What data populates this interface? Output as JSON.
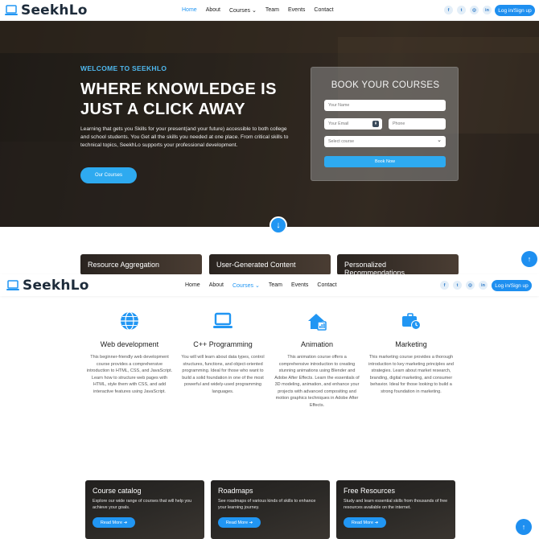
{
  "brand": {
    "name": "SeekhLo",
    "accent": "#2196f3"
  },
  "nav": {
    "links": [
      "Home",
      "About",
      "Courses",
      "Team",
      "Events",
      "Contact"
    ],
    "courses_chevron": "⌄",
    "social": [
      "f",
      "t",
      "◎",
      "in"
    ],
    "login_label": "Log in/Sign up"
  },
  "hero": {
    "welcome": "WELCOME TO SEEKHLO",
    "title": "WHERE KNOWLEDGE IS JUST A CLICK AWAY",
    "description": "Learning that gets you Skills for your present(and your future) accessible to both college and school students. You Get all the skills you needed at one place. From critical skills to technical topics, SeekhLo supports your professional development.",
    "button": "Our Courses"
  },
  "booking": {
    "title": "BOOK YOUR COURSES",
    "name_placeholder": "Your Name",
    "email_placeholder": "Your Email",
    "phone_placeholder": "Phone",
    "select_value": "Select course",
    "submit": "Book Now"
  },
  "features": [
    "Resource Aggregation",
    "User-Generated Content",
    "Personalized Recommendations"
  ],
  "courses": [
    {
      "title": "Web development",
      "icon": "globe-icon",
      "desc": "This beginner-friendly web development course provides a comprehensive introduction to HTML, CSS, and JavaScript. Learn how to structure web pages with HTML, style them with CSS, and add interactive features using JavaScript."
    },
    {
      "title": "C++ Programming",
      "icon": "laptop-icon",
      "desc": "You will will learn about data types, control structures, functions, and object-oriented programming. Ideal for those who want to build a solid foundation in one of the most powerful and widely-used programming languages."
    },
    {
      "title": "Animation",
      "icon": "house-chart-icon",
      "desc": "This animation course offers a comprehensive introduction to creating stunning animations using Blender and Adobe After Effects. Learn the essentials of 3D modeling, animation, and enhance your projects with advanced compositing and motion graphics techniques in Adobe After Effects."
    },
    {
      "title": "Marketing",
      "icon": "briefcase-clock-icon",
      "desc": "This marketing course provides a thorough introduction to key marketing principles and strategies. Learn about market research, branding, digital marketing, and consumer behavior. Ideal for those looking to build a strong foundation in marketing."
    }
  ],
  "cards": [
    {
      "title": "Course catalog",
      "desc": "Explore our wide range of courses that will help you achieve your goals.",
      "button": "Read More ➔"
    },
    {
      "title": "Roadmaps",
      "desc": "See roadmaps of various kinds of skills to enhance your learning journey.",
      "button": "Read More ➔"
    },
    {
      "title": "Free Resources",
      "desc": "Study and learn essential skills from thousands of free resources available on the internet.",
      "button": "Read More ➔"
    }
  ],
  "scroll_top_icon": "↑",
  "down_icon": "↓"
}
